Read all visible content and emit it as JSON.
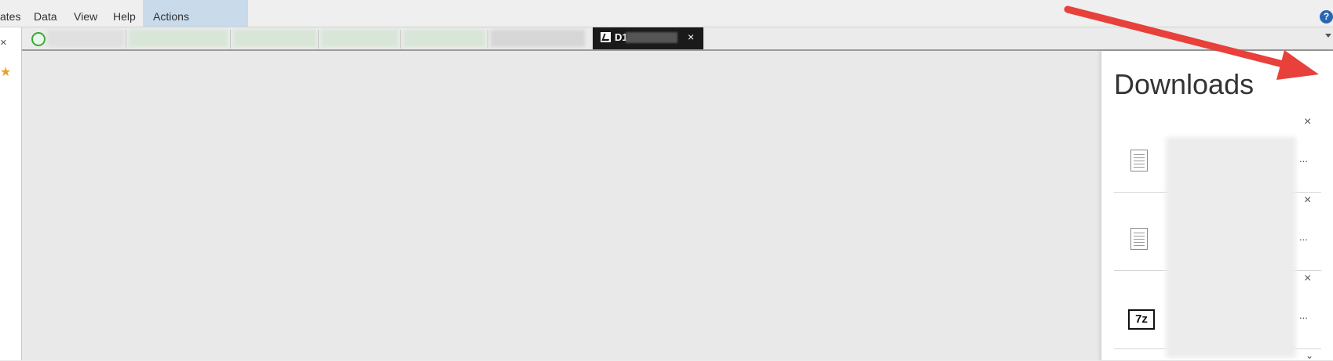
{
  "menubar": {
    "items": [
      {
        "label": "ates"
      },
      {
        "label": "Data"
      },
      {
        "label": "View"
      },
      {
        "label": "Help"
      },
      {
        "label": "Actions"
      }
    ],
    "help_icon": "?"
  },
  "left_strip": {
    "close_glyph": "×",
    "star_glyph": "★"
  },
  "tabs": {
    "active_tab": {
      "label": "D1",
      "close_glyph": "×"
    }
  },
  "downloads": {
    "title": "Downloads",
    "items": [
      {
        "icon": "document-icon",
        "ellipsis": "...",
        "close_glyph": "×"
      },
      {
        "icon": "document-icon",
        "ellipsis": "...",
        "close_glyph": "×"
      },
      {
        "icon": "7z-archive-icon",
        "icon_text": "7z",
        "ellipsis": "...",
        "close_glyph": "×"
      }
    ],
    "more_glyph": "⌄"
  },
  "colors": {
    "accent_menu": "#c9daea",
    "help_blue": "#2a67b3",
    "active_tab_bg": "#1a1a1a",
    "annotation_arrow": "#e8403a"
  }
}
